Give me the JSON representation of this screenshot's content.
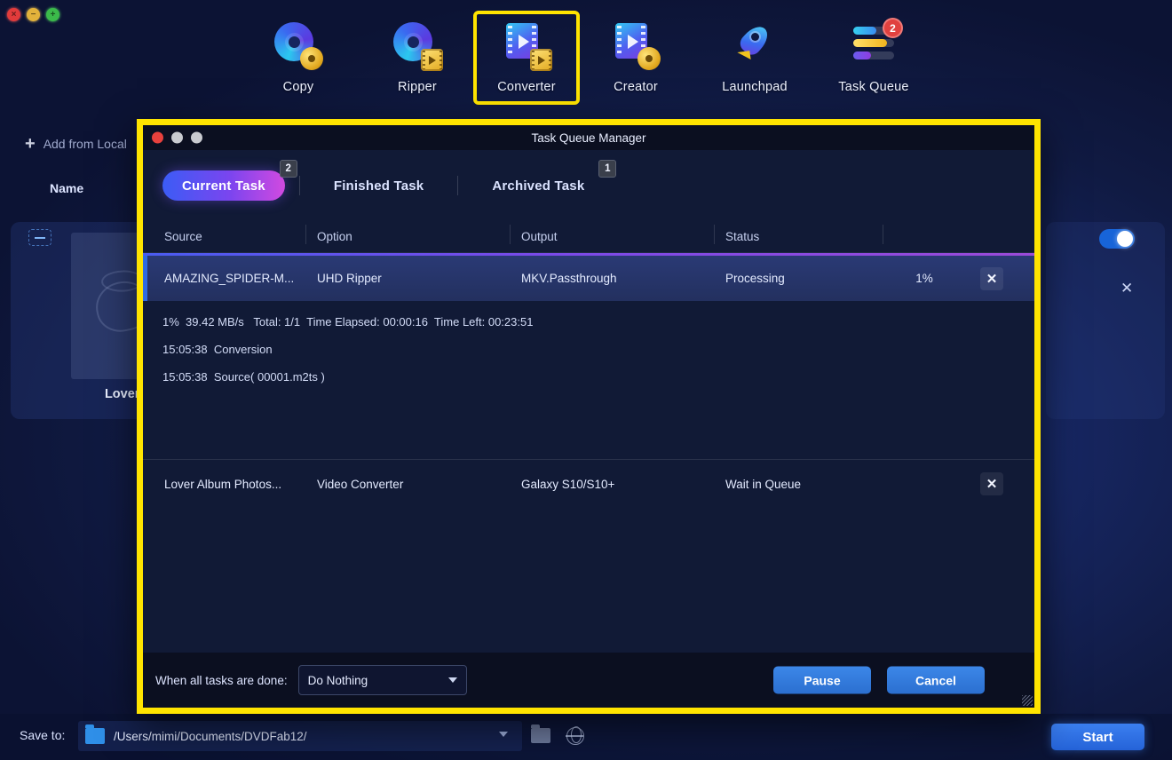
{
  "app": {
    "window_controls": [
      {
        "name": "close",
        "glyph": "×",
        "color": "#e23b3b"
      },
      {
        "name": "minimize",
        "glyph": "−",
        "color": "#e2b23b"
      },
      {
        "name": "maximize",
        "glyph": "+",
        "color": "#3bba4a"
      }
    ],
    "toolbar": [
      {
        "label": "Copy",
        "icon": "disc-copy-icon",
        "selected": false,
        "badge": null
      },
      {
        "label": "Ripper",
        "icon": "disc-ripper-icon",
        "selected": false,
        "badge": null
      },
      {
        "label": "Converter",
        "icon": "film-converter-icon",
        "selected": true,
        "badge": null
      },
      {
        "label": "Creator",
        "icon": "film-creator-icon",
        "selected": false,
        "badge": null
      },
      {
        "label": "Launchpad",
        "icon": "rocket-icon",
        "selected": false,
        "badge": null
      },
      {
        "label": "Task Queue",
        "icon": "task-queue-icon",
        "selected": false,
        "badge": "2"
      }
    ],
    "add_from_local": "Add from Local",
    "column_name": "Name",
    "file_title": "Lover Album",
    "save_to_label": "Save to:",
    "save_to_path": "/Users/mimi/Documents/DVDFab12/",
    "start_label": "Start",
    "accent_blue": "#2f6be0",
    "highlight_yellow": "#ffe400"
  },
  "dialog": {
    "title": "Task Queue Manager",
    "window_controls": [
      "close",
      "minimize",
      "maximize"
    ],
    "tabs": [
      {
        "label": "Current Task",
        "badge": "2",
        "active": true
      },
      {
        "label": "Finished Task",
        "badge": null,
        "active": false
      },
      {
        "label": "Archived Task",
        "badge": "1",
        "active": false
      }
    ],
    "table": {
      "headers": [
        "Source",
        "Option",
        "Output",
        "Status",
        ""
      ],
      "rows": [
        {
          "source": "AMAZING_SPIDER-M...",
          "option": "UHD Ripper",
          "output": "MKV.Passthrough",
          "status": "Processing",
          "percent": "1%",
          "close": "✕",
          "active": true
        },
        {
          "source": "Lover Album Photos...",
          "option": "Video Converter",
          "output": "Galaxy S10/S10+",
          "status": "Wait in Queue",
          "percent": "",
          "close": "✕",
          "active": false
        }
      ]
    },
    "log": [
      "1%  39.42 MB/s   Total: 1/1  Time Elapsed: 00:00:16  Time Left: 00:23:51",
      "15:05:38  Conversion",
      "15:05:38  Source( 00001.m2ts )"
    ],
    "footer": {
      "done_label": "When all tasks are done:",
      "done_value": "Do Nothing",
      "pause_label": "Pause",
      "cancel_label": "Cancel"
    }
  }
}
